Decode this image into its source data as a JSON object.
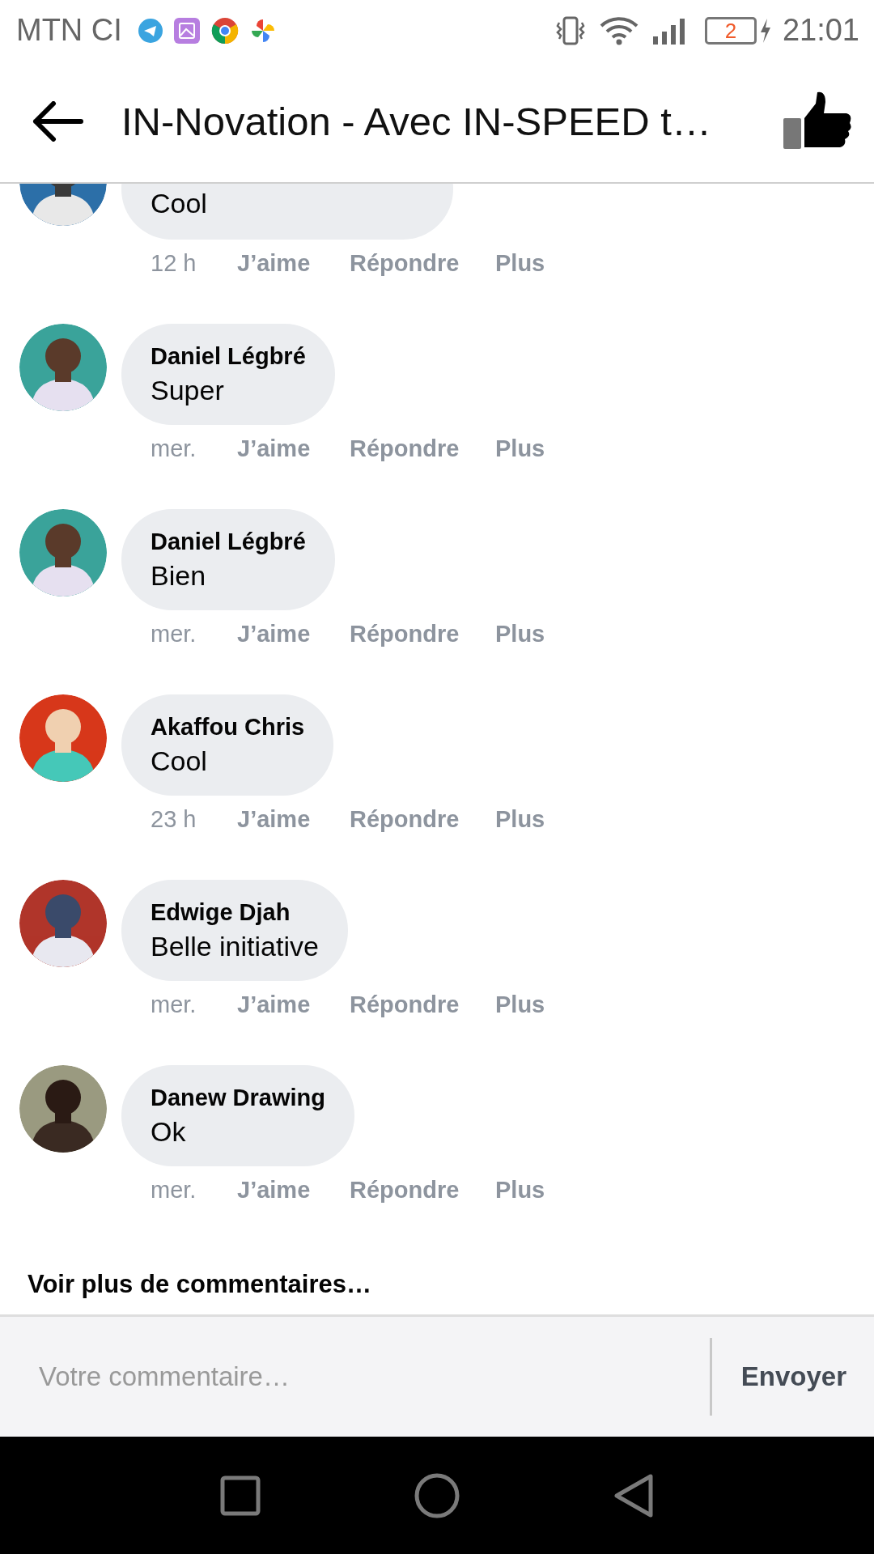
{
  "status_bar": {
    "carrier": "MTN CI",
    "battery_text": "2",
    "time": "21:01"
  },
  "header": {
    "title": "IN-Novation - Avec IN-SPEED t…"
  },
  "comments": [
    {
      "text": "Cool",
      "time": "12 h",
      "actions": [
        "J’aime",
        "Répondre",
        "Plus"
      ]
    },
    {
      "author": "Daniel Légbré",
      "text": "Super",
      "time": "mer.",
      "actions": [
        "J’aime",
        "Répondre",
        "Plus"
      ]
    },
    {
      "author": "Daniel Légbré",
      "text": "Bien",
      "time": "mer.",
      "actions": [
        "J’aime",
        "Répondre",
        "Plus"
      ]
    },
    {
      "author": "Akaffou Chris",
      "text": "Cool",
      "time": "23 h",
      "actions": [
        "J’aime",
        "Répondre",
        "Plus"
      ]
    },
    {
      "author": "Edwige Djah",
      "text": "Belle initiative",
      "time": "mer.",
      "actions": [
        "J’aime",
        "Répondre",
        "Plus"
      ]
    },
    {
      "author": "Danew Drawing",
      "text": "Ok",
      "time": "mer.",
      "actions": [
        "J’aime",
        "Répondre",
        "Plus"
      ]
    }
  ],
  "more_link": "Voir plus de commentaires…",
  "composer": {
    "placeholder": "Votre commentaire…",
    "send": "Envoyer"
  }
}
